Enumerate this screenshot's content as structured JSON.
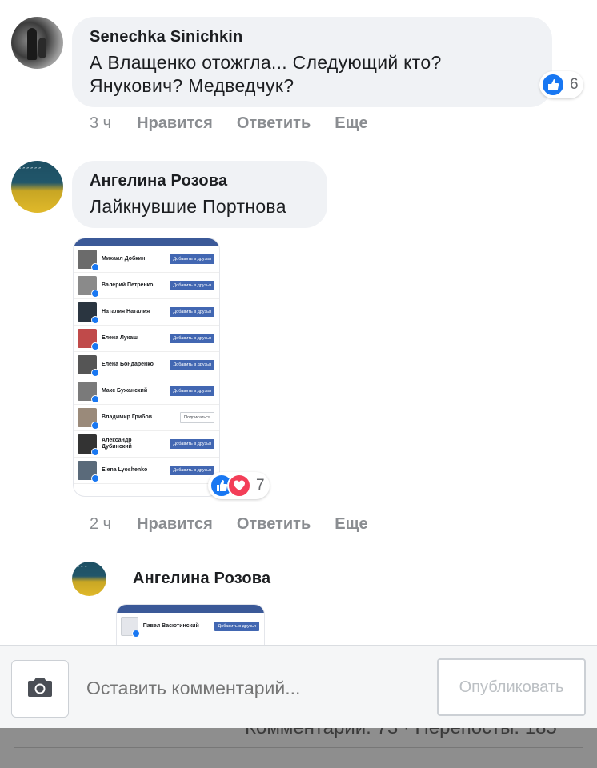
{
  "comments": [
    {
      "author": "Senechka Sinichkin",
      "text": "А Влащенко отожгла... Следующий кто? Янукович? Медведчук?",
      "reactions": {
        "icons": [
          "like-icon"
        ],
        "count": "6"
      },
      "time": "3 ч",
      "like": "Нравится",
      "reply": "Ответить",
      "more": "Еще"
    },
    {
      "author": "Ангелина Розова",
      "text": "Лайкнувшие Портнова",
      "reactions": {
        "icons": [
          "like-icon",
          "love-icon"
        ],
        "count": "7"
      },
      "time": "2 ч",
      "like": "Нравится",
      "reply": "Ответить",
      "more": "Еще"
    }
  ],
  "attachment": {
    "rows": [
      {
        "name": "Михаил Добкин",
        "button": "Добавить в друзья"
      },
      {
        "name": "Валерий Петренко",
        "button": "Добавить в друзья"
      },
      {
        "name": "Наталия Наталия",
        "button": "Добавить в друзья"
      },
      {
        "name": "Елена Лукаш",
        "button": "Добавить в друзья"
      },
      {
        "name": "Елена Бондаренко",
        "button": "Добавить в друзья"
      },
      {
        "name": "Макс Бужанский",
        "button": "Добавить в друзья"
      },
      {
        "name": "Владимир Грибов",
        "button": "Подписаться"
      },
      {
        "name": "Александр Дубинский",
        "button": "Добавить в друзья"
      },
      {
        "name": "Elena Lyoshenko",
        "button": "Добавить в друзья"
      }
    ]
  },
  "reply": {
    "author": "Ангелина Розова",
    "attachment_row": {
      "name": "Павел Васютинский",
      "button": "Добавить в друзья"
    }
  },
  "composer": {
    "placeholder": "Оставить комментарий...",
    "publish_label": "Опубликовать",
    "camera_icon": "camera-icon"
  },
  "underlay": {
    "text": "Комментарии: 73 · Перепосты: 185"
  },
  "colors": {
    "like": "#1877f2",
    "love": "#f33e58",
    "bubble": "#f0f2f5",
    "meta": "#8a8d91"
  }
}
